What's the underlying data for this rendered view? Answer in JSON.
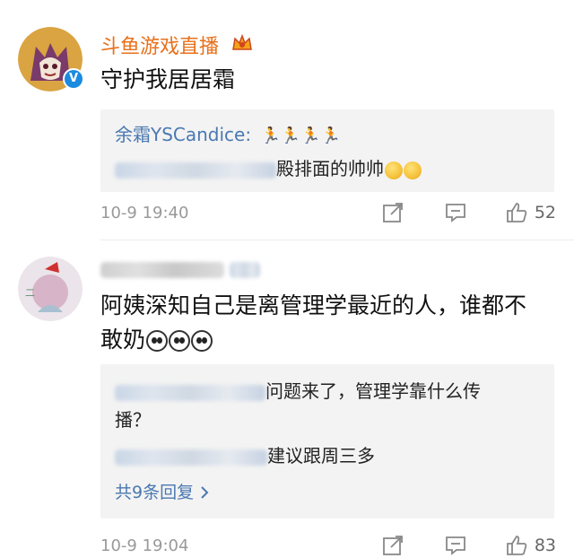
{
  "comment1": {
    "username": "斗鱼游戏直播",
    "text": "守护我居居霜",
    "reply_author": "余霜YSCandice:",
    "reply2_text": "殿排面的帅帅",
    "time": "10-9 19:40",
    "likes": "52"
  },
  "comment2": {
    "text_line1": "阿姨深知自己是离管理学最近的人，谁都不",
    "text_line2": "敢奶",
    "reply1_text": "问题来了，管理学靠什么传",
    "reply1_cont": "播？",
    "reply2_text": "建议跟周三多",
    "more_replies": "共9条回复",
    "time": "10-9 19:04",
    "likes": "83"
  },
  "colors": {
    "username": "#e8711b",
    "link": "#4a78b0",
    "verified": "#1b8be0"
  },
  "icons": [
    "crown-icon",
    "verified-icon",
    "share-icon",
    "comment-icon",
    "like-icon",
    "chevron-right-icon"
  ]
}
